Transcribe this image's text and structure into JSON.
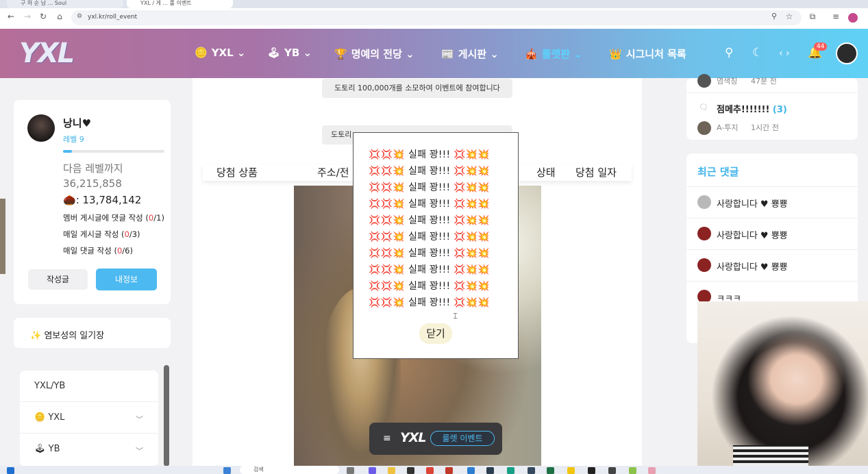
{
  "browser": {
    "tabs": [
      {
        "label": "구 하 순 남 ... Soul"
      },
      {
        "label": "YXL / 게 ... 롤 이벤트"
      }
    ],
    "url": "yxl.kr/roll_event"
  },
  "header": {
    "logo": "YXL",
    "nav": [
      {
        "icon": "🪙",
        "label": "YXL",
        "chevron": true
      },
      {
        "icon": "🕹",
        "label": "YB",
        "chevron": true
      },
      {
        "icon": "🏆",
        "label": "명예의 전당",
        "chevron": true
      },
      {
        "icon": "📰",
        "label": "게시판",
        "chevron": true
      },
      {
        "icon": "🎪",
        "label": "룰렛판",
        "chevron": true
      },
      {
        "icon": "👑",
        "label": "시그니처 목록",
        "chevron": false
      }
    ],
    "notification_count": "44"
  },
  "profile": {
    "name": "낭니♥",
    "level": "레벨 9",
    "level_progress": 0.09,
    "next_level_label": "다음 레벨까지",
    "next_level_value": "36,215,858",
    "acorn_icon": "🌰",
    "acorns": ": 13,784,142",
    "missions": [
      {
        "label": "멤버 게시글에 댓글 작성 (",
        "done": "0",
        "total": "/1)"
      },
      {
        "label": "매일 게시글 작성 (",
        "done": "0",
        "total": "/3)"
      },
      {
        "label": "매일 댓글 작성 (",
        "done": "0",
        "total": "/6)"
      }
    ],
    "btn_posts": "작성글",
    "btn_myinfo": "내정보"
  },
  "diary": {
    "icon": "✨",
    "label": "염보성의 일기장"
  },
  "side_menu": {
    "title": "YXL/YB",
    "items": [
      {
        "icon": "🪙",
        "label": "YXL"
      },
      {
        "icon": "🕹",
        "label": "YB"
      }
    ]
  },
  "main": {
    "notice1": "도토리 100,000개를 소모하여 이벤트에 참여합니다",
    "notice2": "도토리",
    "columns": [
      "당첨 상품",
      "주소/전",
      "상태",
      "당첨 일자"
    ]
  },
  "popup": {
    "fail_lines": [
      "실패 꽝!!!",
      "실패 꽝!!!",
      "실패 꽝!!!",
      "실패 꽝!!!",
      "실패 꽝!!!",
      "실패 꽝!!!",
      "실패 꽝!!!",
      "실패 꽝!!!",
      "실패 꽝!!!",
      "실패 꽝!!!"
    ],
    "prefix_icons": "💢💢💥",
    "suffix_icons": "💢💥💥",
    "close_label": "닫기"
  },
  "right": {
    "top_meta_author": "염색칭",
    "top_meta_time": "47분 전",
    "post": {
      "title": "점메추!!!!!!!",
      "count": "(3)",
      "author": "A-투지",
      "time": "1시간 전"
    },
    "recent_comments_title": "최근 댓글",
    "comments": [
      {
        "text": "사랑합니다 ♥ 뿅뿅"
      },
      {
        "text": "사랑합니다 ♥ 뿅뿅"
      },
      {
        "text": "사랑합니다 ♥ 뿅뿅"
      },
      {
        "text": "ㅋㅋㅋ"
      }
    ]
  },
  "player": {
    "logo": "YXL",
    "button": "룰렛 이벤트"
  },
  "taskbar": {
    "search_placeholder": "검색"
  },
  "colors": {
    "accent": "#4cb9f0",
    "fail_red": "#d9453d",
    "mission_red": "#e0393e"
  }
}
